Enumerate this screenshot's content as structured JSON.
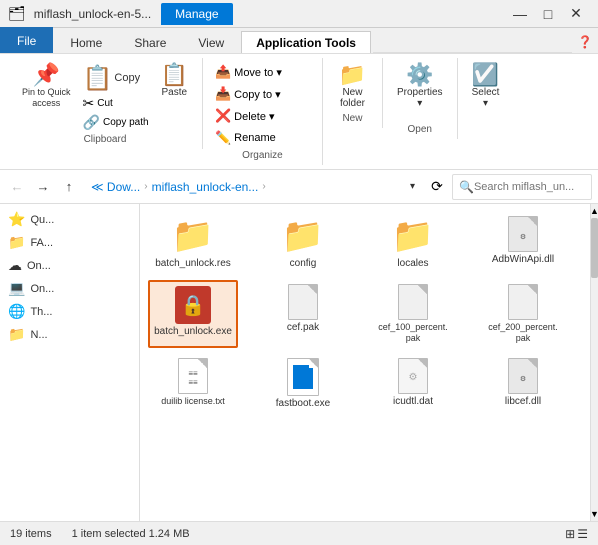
{
  "titleBar": {
    "title": "miflash_unlock-en-5...",
    "manageTab": "Manage",
    "controls": {
      "minimize": "—",
      "maximize": "□",
      "close": "✕"
    }
  },
  "ribbon": {
    "tabs": [
      "File",
      "Home",
      "Share",
      "View",
      "Application Tools"
    ],
    "activeTab": "Application Tools",
    "groups": {
      "clipboard": {
        "label": "Clipboard",
        "pin": {
          "icon": "📌",
          "label": "Pin to Quick\naccess"
        },
        "copy": {
          "icon": "📋",
          "label": "Copy"
        },
        "paste": {
          "icon": "📋",
          "label": "Paste"
        },
        "cut": {
          "icon": "✂",
          "label": ""
        },
        "copyPath": {
          "icon": "📋",
          "label": ""
        },
        "copyTo": {
          "icon": "⊡",
          "label": "Copy to"
        }
      },
      "organize": {
        "label": "Organize",
        "moveTo": "Move to ▾",
        "copyTo": "Copy to ▾",
        "delete": "Delete ▾",
        "rename": "Rename"
      },
      "new": {
        "label": "New",
        "newFolder": {
          "icon": "📁",
          "label": "New\nfolder"
        }
      },
      "open": {
        "label": "Open",
        "properties": {
          "icon": "🔧",
          "label": "Properties"
        }
      },
      "select": {
        "label": "",
        "select": {
          "icon": "☑",
          "label": "Select"
        }
      }
    }
  },
  "navBar": {
    "back": "←",
    "forward": "→",
    "up": "↑",
    "breadcrumb": [
      "≪ Dow...",
      "miflash_unlock-en...",
      ""
    ],
    "refresh": "⟳",
    "searchPlaceholder": "Search miflash_un..."
  },
  "sidebar": {
    "items": [
      {
        "id": "quick-access",
        "icon": "⭐",
        "label": "Qu...",
        "selected": false
      },
      {
        "id": "fa",
        "icon": "📁",
        "label": "FA...",
        "selected": false
      },
      {
        "id": "one-drive",
        "icon": "☁",
        "label": "On...",
        "selected": false
      },
      {
        "id": "this-pc",
        "icon": "💻",
        "label": "On...",
        "selected": false
      },
      {
        "id": "network",
        "icon": "🖧",
        "label": "Th...",
        "selected": false
      },
      {
        "id": "n-item",
        "icon": "📁",
        "label": "N...",
        "selected": false
      }
    ]
  },
  "files": [
    {
      "id": "batch_unlock_res",
      "name": "batch_unlock.res",
      "type": "folder",
      "selected": false
    },
    {
      "id": "config",
      "name": "config",
      "type": "folder",
      "selected": false
    },
    {
      "id": "locales",
      "name": "locales",
      "type": "folder",
      "selected": false
    },
    {
      "id": "adbwinapi",
      "name": "AdbWinApi.dll",
      "type": "dll",
      "selected": false
    },
    {
      "id": "batch_unlock_exe",
      "name": "batch_unlock.exe",
      "type": "exe",
      "selected": true
    },
    {
      "id": "cef_pak",
      "name": "cef.pak",
      "type": "pak",
      "selected": false
    },
    {
      "id": "cef_100",
      "name": "cef_100_percent.\npak",
      "type": "pak",
      "selected": false
    },
    {
      "id": "cef_200",
      "name": "cef_200_percent.\npak",
      "type": "pak",
      "selected": false
    },
    {
      "id": "duilib",
      "name": "duilib license.txt",
      "type": "txt",
      "selected": false
    },
    {
      "id": "fastboot",
      "name": "fastboot.exe",
      "type": "fastboot",
      "selected": false
    },
    {
      "id": "icudtl",
      "name": "icudtl.dat",
      "type": "dat",
      "selected": false
    },
    {
      "id": "libcef",
      "name": "libcef.dll",
      "type": "dll",
      "selected": false
    }
  ],
  "statusBar": {
    "itemCount": "19 items",
    "selectedInfo": "1 item selected  1.24 MB"
  }
}
